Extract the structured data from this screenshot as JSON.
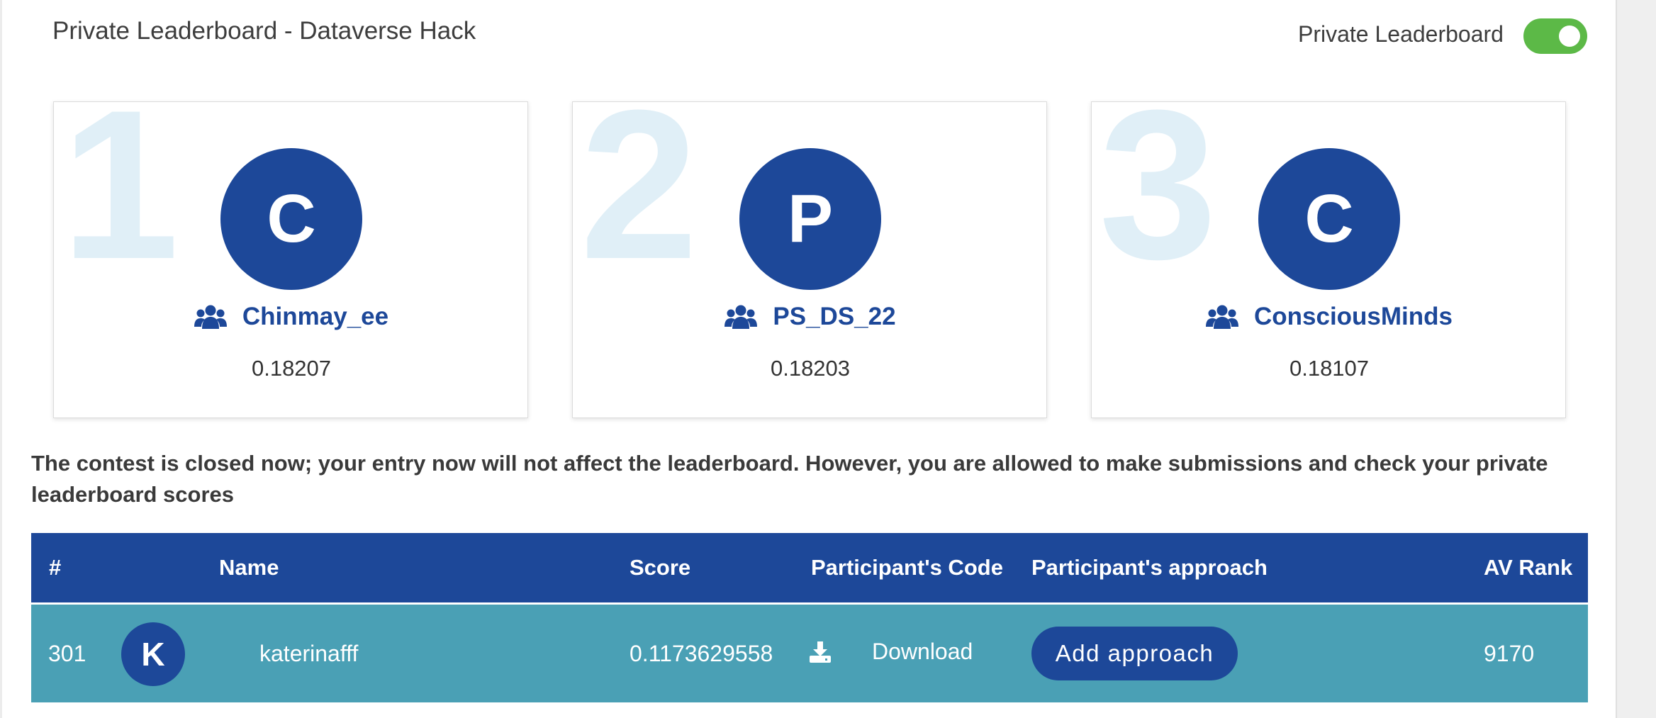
{
  "header": {
    "title": "Private Leaderboard - Dataverse Hack",
    "toggle_label": "Private Leaderboard",
    "toggle_on": true
  },
  "podium": [
    {
      "rank": "1",
      "initial": "C",
      "team_icon": "team-icon",
      "name": "Chinmay_ee",
      "score": "0.18207"
    },
    {
      "rank": "2",
      "initial": "P",
      "team_icon": "team-icon",
      "name": "PS_DS_22",
      "score": "0.18203"
    },
    {
      "rank": "3",
      "initial": "C",
      "team_icon": "team-icon",
      "name": "ConsciousMinds",
      "score": "0.18107"
    }
  ],
  "notice": "The contest is closed now; your entry now will not affect the leaderboard. However, you are allowed to make submissions and check your private leaderboard scores",
  "table": {
    "headers": {
      "rank": "#",
      "name": "Name",
      "score": "Score",
      "code": "Participant's Code",
      "approach": "Participant's approach",
      "av_rank": "AV Rank"
    },
    "row": {
      "rank": "301",
      "initial": "K",
      "name": "katerinafff",
      "score": "0.1173629558",
      "download_icon": "download-icon",
      "download_label": "Download",
      "approach_button": "Add approach",
      "av_rank": "9170"
    }
  },
  "colors": {
    "brand_blue": "#1d4899",
    "row_teal": "#4aa0b5",
    "toggle_green": "#5cb947",
    "rank_watermark": "#e0eff7"
  }
}
